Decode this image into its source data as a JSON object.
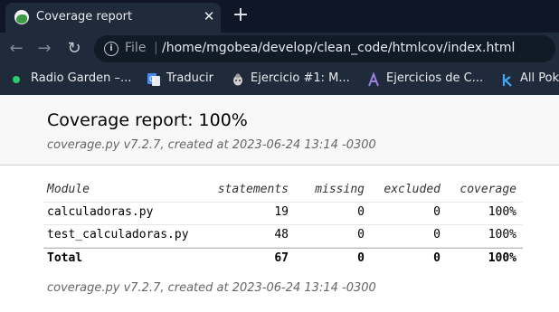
{
  "browser": {
    "tab": {
      "title": "Coverage report",
      "favicon": "radio-garden-favicon-icon",
      "close_glyph": "✕"
    },
    "new_tab_glyph": "+",
    "nav": {
      "back_glyph": "←",
      "forward_glyph": "→",
      "reload_glyph": "↻"
    },
    "address_bar": {
      "info_glyph": "i",
      "scheme_label": "File",
      "separator": "|",
      "url": "/home/mgobea/develop/clean_code/htmlcov/index.html"
    },
    "bookmarks": [
      {
        "label": "Radio Garden –...",
        "icon": "green-dot-icon"
      },
      {
        "label": "Traducir",
        "icon": "google-translate-icon"
      },
      {
        "label": "Ejercicio #1: M...",
        "icon": "bug-icon"
      },
      {
        "label": "Ejercicios de C...",
        "icon": "a-logo-icon"
      },
      {
        "label": "All Pok",
        "icon": "k-logo-icon"
      }
    ]
  },
  "report": {
    "title": "Coverage report: 100%",
    "meta": "coverage.py v7.2.7, created at 2023-06-24 13:14 -0300",
    "footer_meta": "coverage.py v7.2.7, created at 2023-06-24 13:14 -0300",
    "columns": {
      "module": "Module",
      "statements": "statements",
      "missing": "missing",
      "excluded": "excluded",
      "coverage": "coverage"
    },
    "rows": [
      {
        "module": "calculadoras.py",
        "statements": "19",
        "missing": "0",
        "excluded": "0",
        "coverage": "100%"
      },
      {
        "module": "test_calculadoras.py",
        "statements": "48",
        "missing": "0",
        "excluded": "0",
        "coverage": "100%"
      }
    ],
    "total": {
      "module": "Total",
      "statements": "67",
      "missing": "0",
      "excluded": "0",
      "coverage": "100%"
    }
  },
  "colors": {
    "tabstrip": "#0f1726",
    "toolbar": "#1f2a3a",
    "omnibox": "#111a27",
    "page_header": "#f8f8f8"
  }
}
